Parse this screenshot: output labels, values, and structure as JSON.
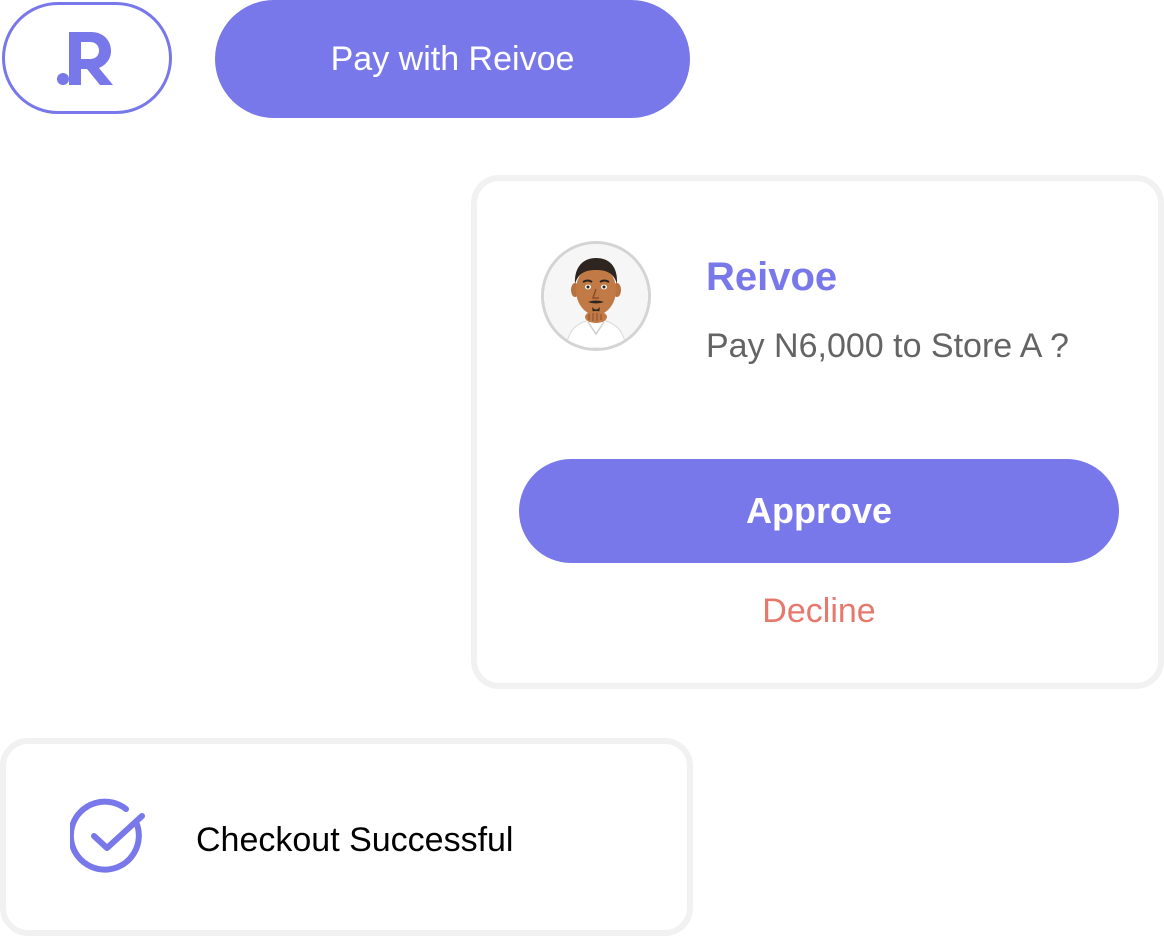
{
  "brand": {
    "logo_icon": "reivoe-logo-icon",
    "accent_color": "#7878ea",
    "decline_color": "#e6786c"
  },
  "pay_button": {
    "label": "Pay with Reivoe"
  },
  "approval": {
    "avatar_icon": "user-avatar-icon",
    "merchant_name": "Reivoe",
    "prompt": "Pay N6,000 to Store A ?",
    "approve_label": "Approve",
    "decline_label": "Decline"
  },
  "status": {
    "icon": "check-circle-icon",
    "message": "Checkout Successful"
  }
}
